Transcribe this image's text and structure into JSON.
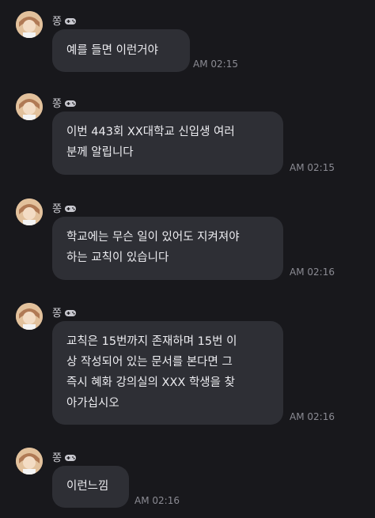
{
  "sender": {
    "name": "쫑",
    "badge_icon": "gamepad-icon"
  },
  "messages": [
    {
      "text": "예를 들면 이런거야",
      "time": "AM 02:15"
    },
    {
      "text": "이번 443회 XX대학교 신입생 여러\n분께 알립니다",
      "time": "AM 02:15"
    },
    {
      "text": "학교에는 무슨 일이 있어도 지켜져야\n하는 교칙이 있습니다",
      "time": "AM 02:16"
    },
    {
      "text": "교칙은 15번까지 존재하며 15번 이\n상 작성되어 있는 문서를 본다면 그\n즉시 혜화 강의실의 XXX 학생을 찾\n아가십시오",
      "time": "AM 02:16"
    },
    {
      "text": "이런느낌",
      "time": "AM 02:16"
    }
  ],
  "colors": {
    "background": "#18181c",
    "bubble": "#2e2f35",
    "text": "#ececf0",
    "timestamp": "#8b8b93"
  }
}
